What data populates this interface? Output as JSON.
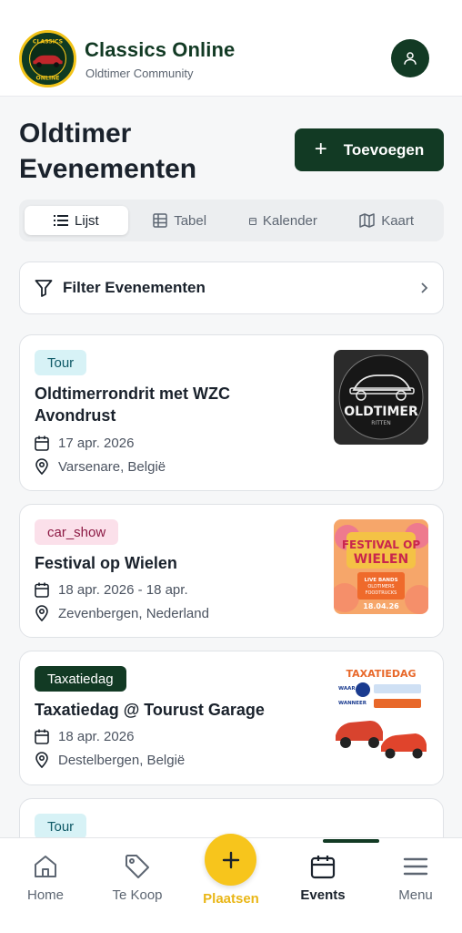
{
  "header": {
    "title": "Classics Online",
    "subtitle": "Oldtimer Community",
    "logo_text_top": "CLASSICS",
    "logo_text_bottom": "ONLINE",
    "profile_icon": "user-icon"
  },
  "page": {
    "title": "Oldtimer Evenementen",
    "add_button_label": "Toevoegen"
  },
  "view_tabs": [
    {
      "label": "Lijst",
      "icon": "list-icon",
      "active": true
    },
    {
      "label": "Tabel",
      "icon": "table-icon",
      "active": false
    },
    {
      "label": "Kalender",
      "icon": "calendar-icon",
      "active": false
    },
    {
      "label": "Kaart",
      "icon": "map-icon",
      "active": false
    }
  ],
  "filter": {
    "label": "Filter Evenementen"
  },
  "events": [
    {
      "badge": "Tour",
      "title": "Oldtimerrondrit met WZC Avondrust",
      "date": "17 apr. 2026",
      "location": "Varsenare, België",
      "thumb_text": "OLDTIMER",
      "thumb_subtext": "RITTEN"
    },
    {
      "badge": "car_show",
      "title": "Festival op Wielen",
      "date": "18 apr. 2026 - 18 apr.",
      "location": "Zevenbergen, Nederland",
      "thumb_text": "FESTIVAL OP WIELEN",
      "thumb_subtext": "LIVE BANDS · OLDTIMERS · FOODTRUCKS · HIPPIE MARKET",
      "thumb_date": "18.04.26"
    },
    {
      "badge": "Taxatiedag",
      "title": "Taxatiedag @ Tourust Garage",
      "date": "18 apr. 2026",
      "location": "Destelbergen, België",
      "thumb_text": "TAXATIEDAG",
      "thumb_label_waar": "WAAR",
      "thumb_label_wanneer": "WANNEER"
    },
    {
      "badge": "Tour"
    }
  ],
  "bottom_nav": {
    "items": [
      {
        "label": "Home",
        "icon": "home-icon"
      },
      {
        "label": "Te Koop",
        "icon": "tag-icon"
      },
      {
        "label": "Plaatsen",
        "icon": "plus-icon"
      },
      {
        "label": "Events",
        "icon": "calendar-icon",
        "active": true
      },
      {
        "label": "Menu",
        "icon": "menu-icon"
      }
    ]
  },
  "colors": {
    "brand_green": "#123a24",
    "accent_yellow": "#f7c51c",
    "tour_badge_bg": "#d7f2f6",
    "carshow_badge_bg": "#fbe0ea"
  }
}
